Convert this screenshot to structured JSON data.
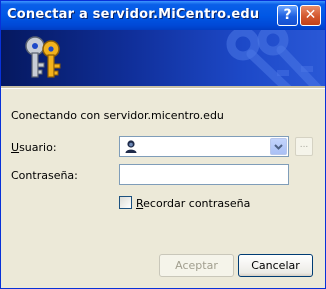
{
  "window": {
    "title": "Conectar a servidor.MiCentro.edu"
  },
  "titlebar": {
    "help_glyph": "?",
    "close_glyph": "✕"
  },
  "banner": {
    "icon": "keys-icon",
    "watermark": "keys-watermark"
  },
  "dialog": {
    "message": "Conectando con servidor.micentro.edu",
    "user_label_first": "U",
    "user_label_rest": "suario:",
    "user_value": "",
    "browse_label": "...",
    "password_label": "Contraseña:",
    "password_value": "",
    "remember_label_first": "R",
    "remember_label_rest": "ecordar contraseña",
    "remember_checked": false
  },
  "buttons": {
    "ok": "Aceptar",
    "cancel": "Cancelar",
    "ok_enabled": false
  },
  "colors": {
    "titlebar": "#0058e6",
    "dialog_bg": "#ece9d8",
    "banner": "#102f9a",
    "close": "#c24119"
  }
}
